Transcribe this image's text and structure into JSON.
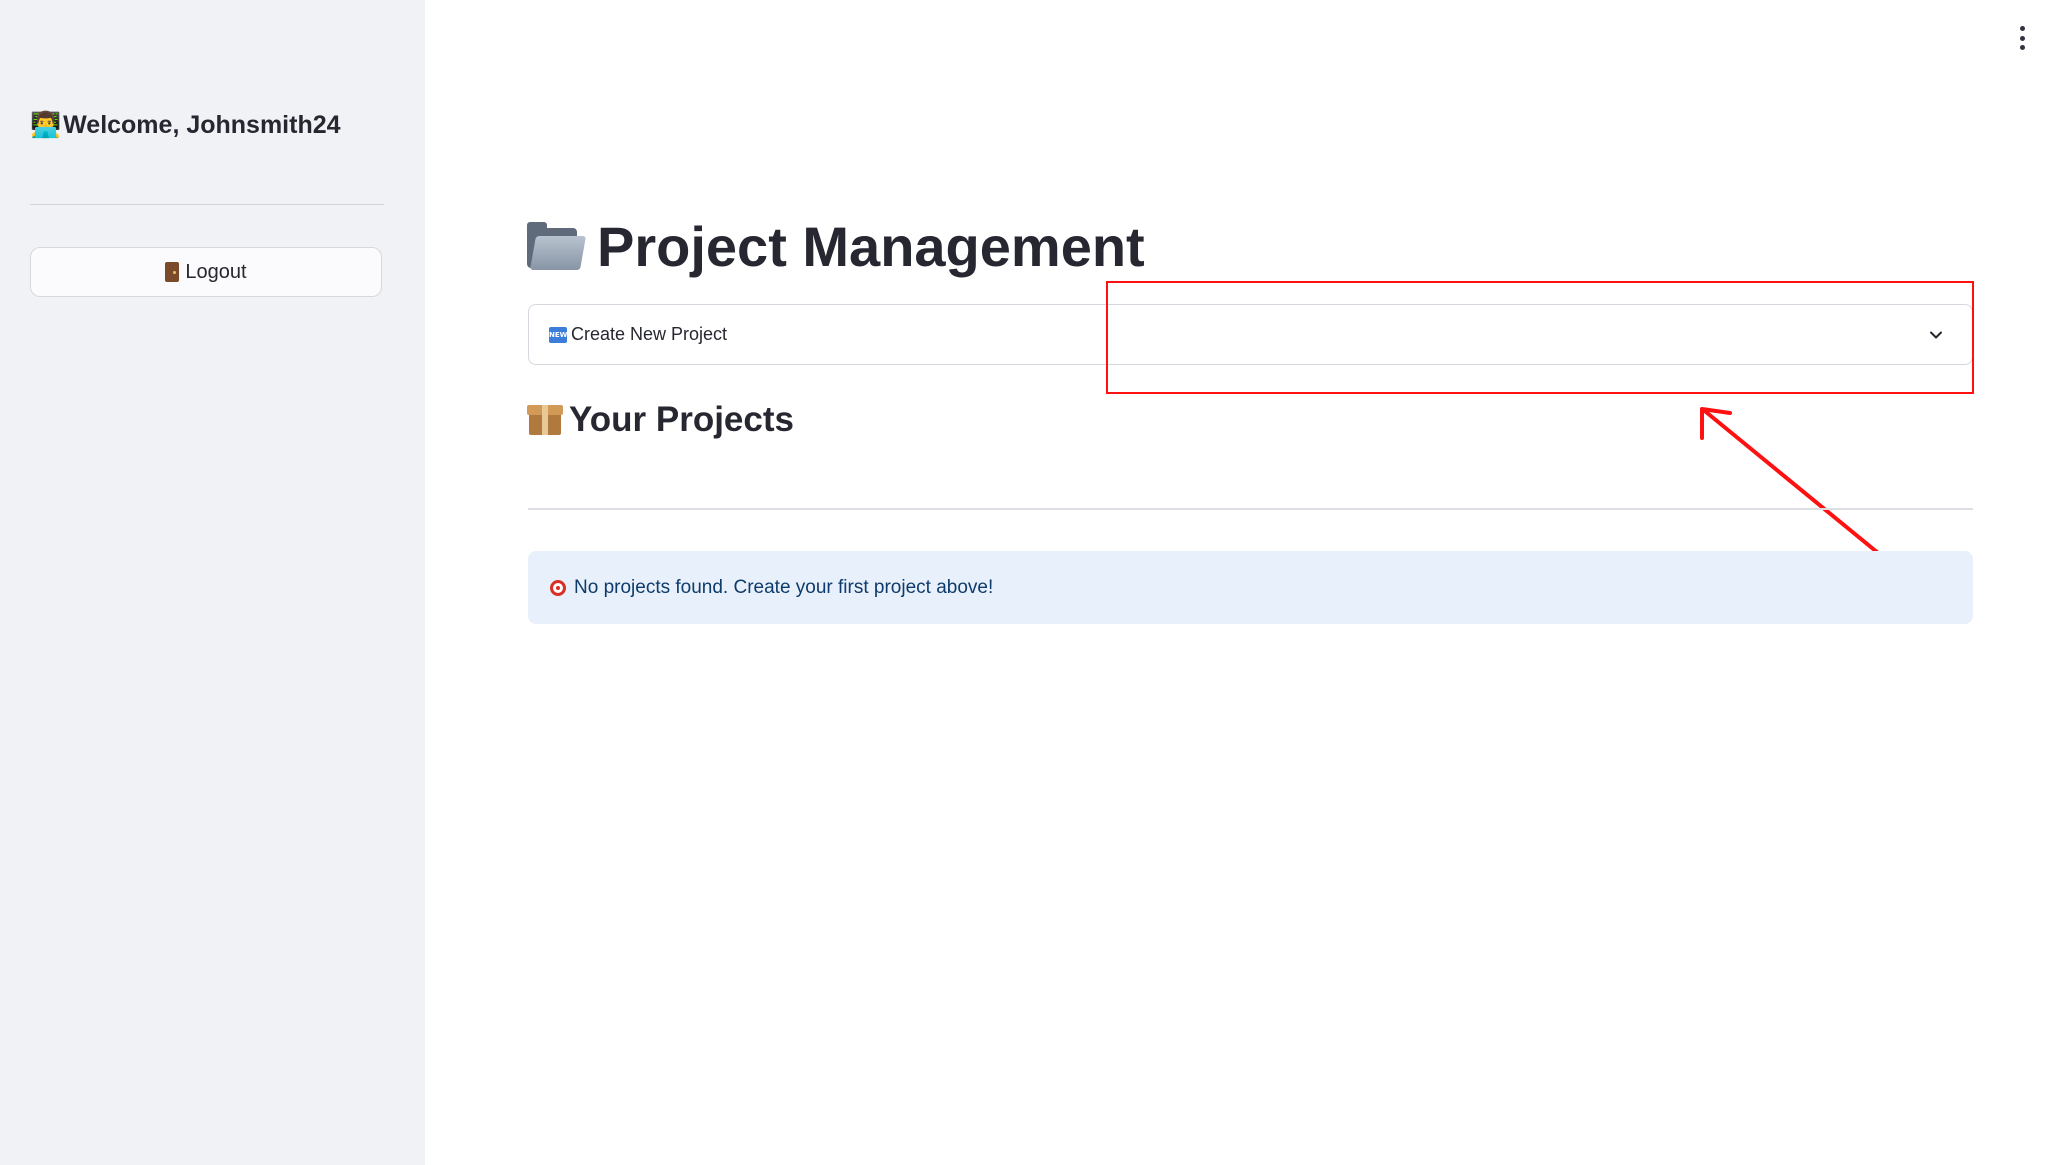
{
  "sidebar": {
    "welcome_emoji": "👨‍💻",
    "welcome_text": "Welcome, Johnsmith24",
    "logout_label": "Logout"
  },
  "main": {
    "title": "Project Management",
    "expander": {
      "label": "Create New Project",
      "badge": "NEW",
      "expanded": false
    },
    "section_title": "Your Projects",
    "info_message": "No projects found. Create your first project above!"
  },
  "annotation": {
    "color": "#ff1111",
    "type": "highlight-box-with-arrow"
  },
  "colors": {
    "sidebar_bg": "#f0f2f6",
    "info_bg": "#e8f1fb",
    "info_text": "#0e3b6b",
    "text": "#262730"
  },
  "icons": {
    "welcome": "technologist-emoji",
    "logout": "door-icon",
    "title": "open-folder-icon",
    "expander_badge": "new-badge-icon",
    "expander_toggle": "chevron-down-icon",
    "section": "package-icon",
    "info": "target-icon",
    "menu": "kebab-menu-icon"
  }
}
